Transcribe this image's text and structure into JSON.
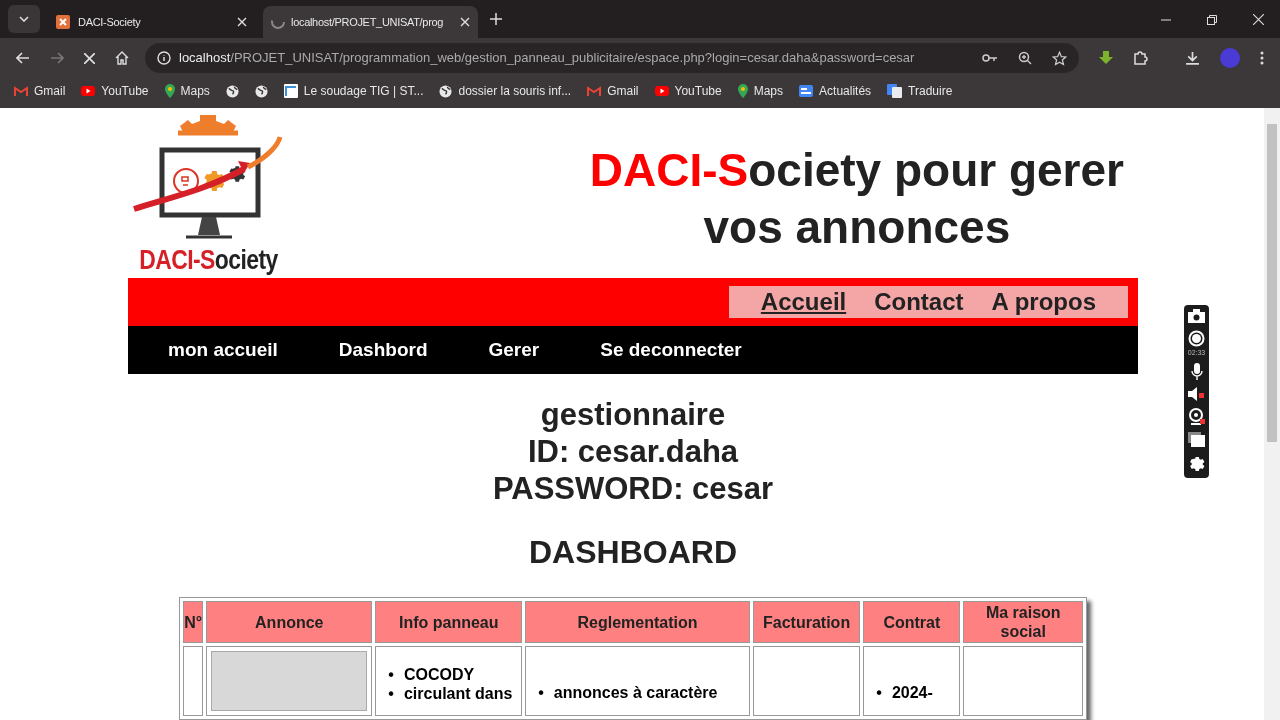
{
  "browser": {
    "tabs": [
      {
        "title": "DACI-Society",
        "selected": false
      },
      {
        "title": "localhost/PROJET_UNISAT/prog",
        "selected": true
      }
    ],
    "url": {
      "host": "localhost",
      "path": "/PROJET_UNISAT/programmation_web/gestion_panneau_publicitaire/espace.php?login=cesar.daha&password=cesar"
    },
    "bookmarks": [
      {
        "label": "Gmail",
        "kind": "gmail"
      },
      {
        "label": "YouTube",
        "kind": "youtube"
      },
      {
        "label": "Maps",
        "kind": "maps"
      },
      {
        "kind": "globe"
      },
      {
        "kind": "globe"
      },
      {
        "label": "Le soudage TIG | ST...",
        "kind": "site"
      },
      {
        "label": "dossier la souris inf...",
        "kind": "globe"
      },
      {
        "label": "Gmail",
        "kind": "gmail"
      },
      {
        "label": "YouTube",
        "kind": "youtube"
      },
      {
        "label": "Maps",
        "kind": "maps"
      },
      {
        "label": "Actualités",
        "kind": "news"
      },
      {
        "label": "Traduire",
        "kind": "translate"
      }
    ]
  },
  "page": {
    "logo": {
      "accent": "DACI-S",
      "rest": "ociety"
    },
    "title": {
      "accent": "DACI-S",
      "rest": "ociety pour gerer",
      "line2": "vos annonces"
    },
    "top_nav": [
      {
        "label": "Accueil",
        "selected": true
      },
      {
        "label": "Contact",
        "selected": false
      },
      {
        "label": "A propos",
        "selected": false
      }
    ],
    "main_nav": [
      "mon accueil",
      "Dashbord",
      "Gerer",
      "Se deconnecter"
    ],
    "profile": [
      "gestionnaire",
      "ID: cesar.daha",
      "PASSWORD: cesar"
    ],
    "heading": "DASHBOARD",
    "table": {
      "columns": [
        "N°",
        "Annonce",
        "Info panneau",
        "Reglementation",
        "Facturation",
        "Contrat",
        "Ma raison social"
      ],
      "bullet": "•",
      "rows": [
        {
          "info": [
            "COCODY",
            "circulant dans"
          ],
          "reglementation": [
            "annonces à caractère"
          ],
          "contrat": [
            "2024-"
          ]
        }
      ]
    }
  },
  "recorder": {
    "time": "02:33"
  }
}
